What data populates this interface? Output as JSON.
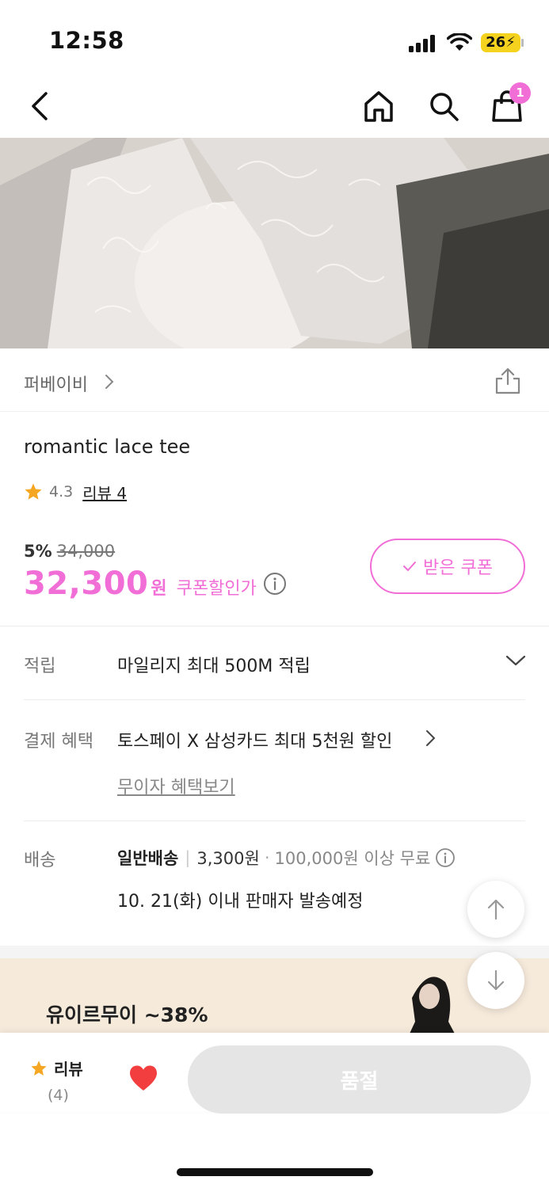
{
  "status": {
    "time": "12:58",
    "battery": "26"
  },
  "nav": {
    "cart_count": "1"
  },
  "brand": {
    "name": "퍼베이비"
  },
  "product": {
    "title": "romantic lace tee",
    "rating": "4.3",
    "review_link": "리뷰 4"
  },
  "price": {
    "discount": "5%",
    "original": "34,000",
    "sale": "32,300",
    "currency": "원",
    "coupon_label": "쿠폰할인가",
    "coupon_button": "받은 쿠폰"
  },
  "mileage": {
    "label": "적립",
    "value": "마일리지 최대 500M 적립"
  },
  "payment": {
    "label": "결제 혜택",
    "value": "토스페이 X 삼성카드 최대 5천원 할인",
    "interest_link": "무이자 혜택보기"
  },
  "shipping": {
    "label": "배송",
    "type": "일반배송",
    "fee": "3,300원",
    "free_condition": "100,000원 이상 무료",
    "date": "10. 21(화) 이내 판매자 발송예정"
  },
  "promo": {
    "text": "유이르무이 ~38%"
  },
  "bottom": {
    "review_label": "리뷰",
    "review_count": "(4)",
    "soldout": "품절"
  },
  "colors": {
    "accent": "#f06ed6",
    "star": "#f5a623",
    "heart": "#f23e3e"
  }
}
